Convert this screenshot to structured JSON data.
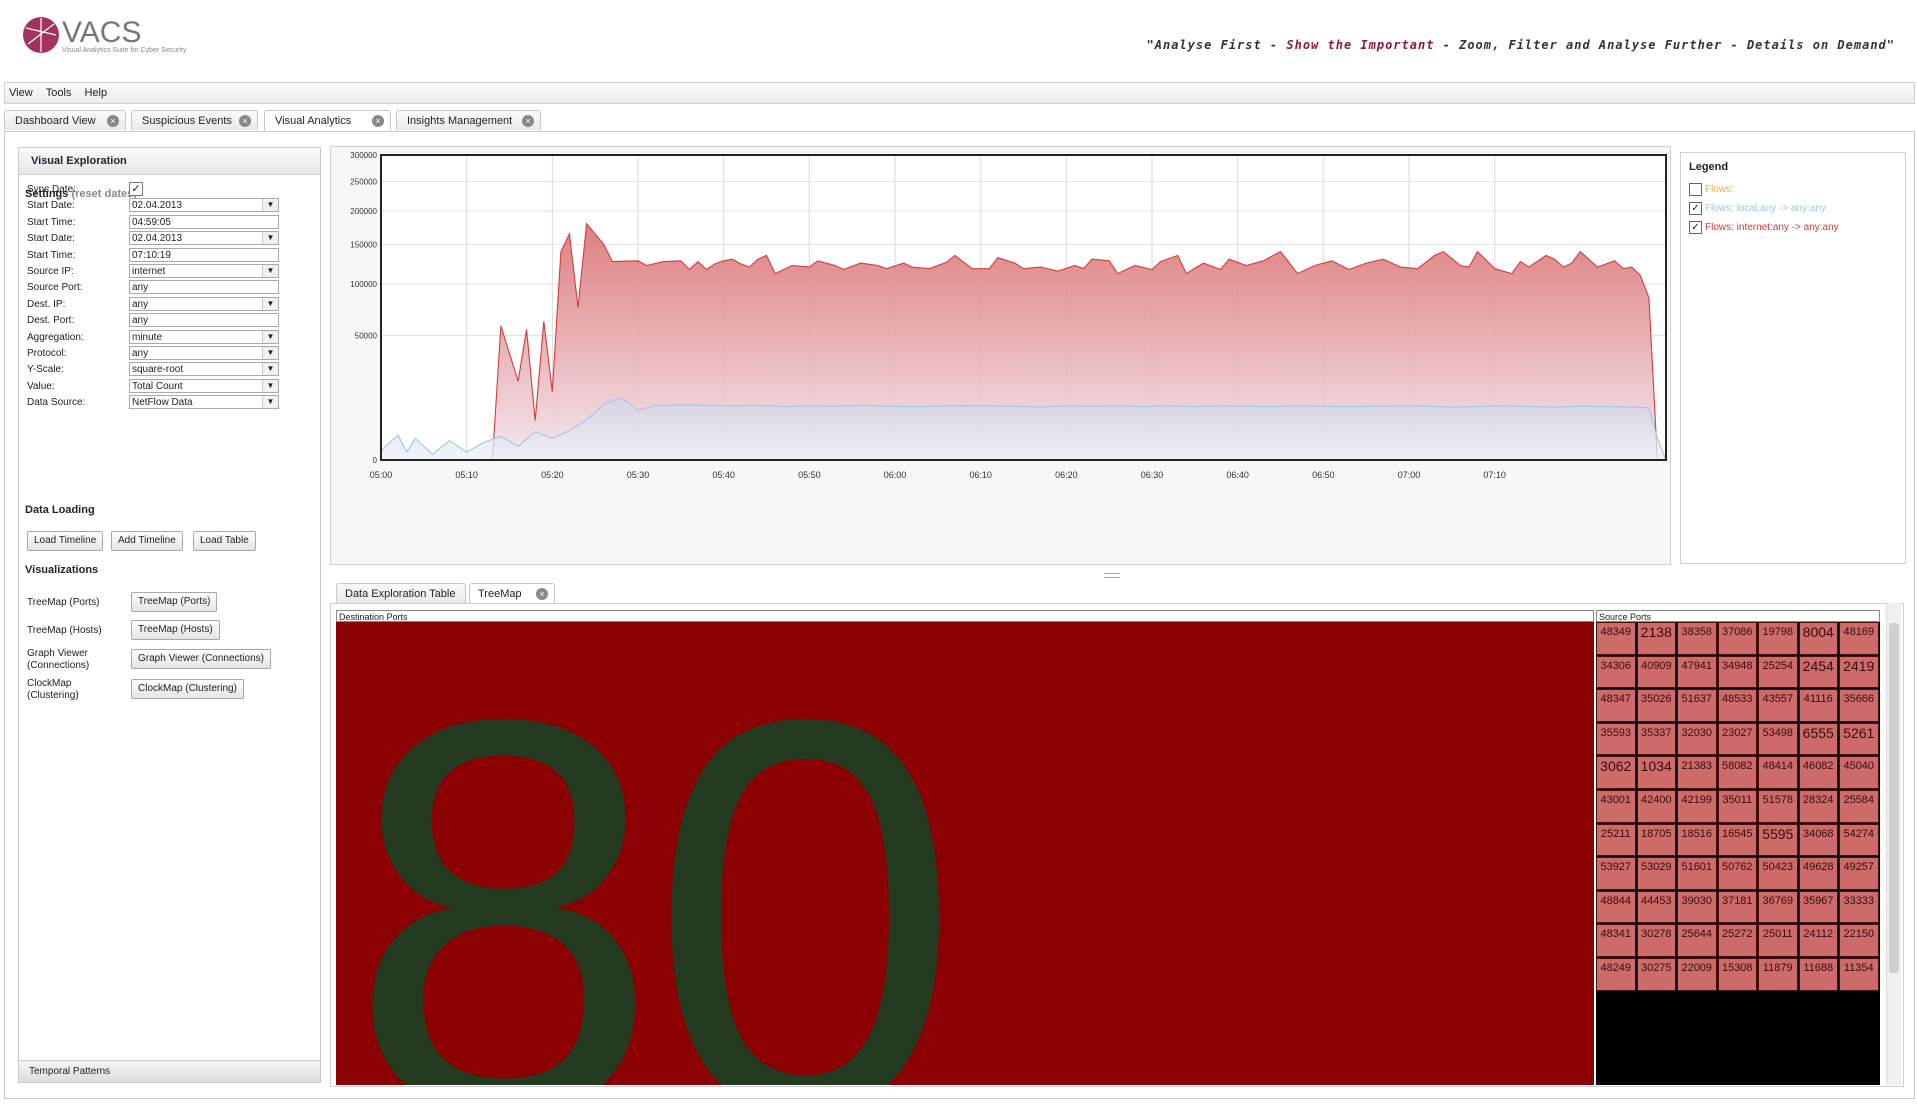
{
  "app": {
    "logo_text": "VACS",
    "logo_subtitle": "Visual Analytics Suite for Cyber Security",
    "tagline_parts": [
      "\"Analyse First - ",
      "Show the Important",
      " - Zoom, Filter and Analyse Further - Details on Demand\""
    ]
  },
  "menu": [
    "View",
    "Tools",
    "Help"
  ],
  "tabs": [
    {
      "label": "Dashboard View"
    },
    {
      "label": "Suspicious Events"
    },
    {
      "label": "Visual Analytics"
    },
    {
      "label": "Insights Management"
    }
  ],
  "left_panel": {
    "title": "Visual Exploration",
    "settings_title": "Settings",
    "reset_link": "(reset dates)",
    "fields": [
      {
        "label": "Sync Date:",
        "type": "checkbox",
        "value": "✓"
      },
      {
        "label": "Start Date:",
        "type": "select",
        "value": "02.04.2013"
      },
      {
        "label": "Start Time:",
        "type": "text",
        "value": "04:59:05"
      },
      {
        "label": "Start Date:",
        "type": "select",
        "value": "02.04.2013"
      },
      {
        "label": "Start Time:",
        "type": "text",
        "value": "07:10:19"
      },
      {
        "label": "Source IP:",
        "type": "select",
        "value": "internet"
      },
      {
        "label": "Source Port:",
        "type": "text",
        "value": "any"
      },
      {
        "label": "Dest. IP:",
        "type": "select",
        "value": "any"
      },
      {
        "label": "Dest. Port:",
        "type": "text",
        "value": "any"
      },
      {
        "label": "Aggregation:",
        "type": "select",
        "value": "minute"
      },
      {
        "label": "Protocol:",
        "type": "select",
        "value": "any"
      },
      {
        "label": "Y-Scale:",
        "type": "select",
        "value": "square-root"
      },
      {
        "label": "Value:",
        "type": "select",
        "value": "Total Count"
      },
      {
        "label": "Data Source:",
        "type": "select",
        "value": "NetFlow Data"
      }
    ],
    "data_loading_title": "Data Loading",
    "load_buttons": [
      "Load Timeline",
      "Add Timeline",
      "Load Table"
    ],
    "visualizations_title": "Visualizations",
    "visualizations": [
      {
        "label": "TreeMap (Ports)",
        "button": "TreeMap (Ports)"
      },
      {
        "label": "TreeMap (Hosts)",
        "button": "TreeMap (Hosts)"
      },
      {
        "label": "Graph Viewer (Connections)",
        "button": "Graph Viewer (Connections)"
      },
      {
        "label": "ClockMap (Clustering)",
        "button": "ClockMap (Clustering)"
      }
    ],
    "footer": "Temporal Patterns"
  },
  "legend": {
    "title": "Legend",
    "items": [
      {
        "label": "Flows:",
        "checked": false,
        "color": "#e8b04a"
      },
      {
        "label": "Flows: local:any -> any:any",
        "checked": true,
        "color": "#9ec4e6"
      },
      {
        "label": "Flows: internet:any -> any:any",
        "checked": true,
        "color": "#d23c3c"
      }
    ]
  },
  "chart_data": {
    "type": "area",
    "yscale": "square-root",
    "ylim": [
      0,
      300000
    ],
    "y_ticks": [
      0,
      50000,
      100000,
      150000,
      200000,
      250000,
      300000
    ],
    "x_ticks": [
      "05:00",
      "05:10",
      "05:20",
      "05:30",
      "05:40",
      "05:50",
      "06:00",
      "06:10",
      "06:20",
      "06:30",
      "06:40",
      "06:50",
      "07:00",
      "07:10"
    ],
    "x_range_minutes": [
      0,
      130
    ],
    "grid": true,
    "series": [
      {
        "name": "Flows: internet:any -> any:any",
        "color": "#d23c3c",
        "points": [
          [
            0,
            0
          ],
          [
            13,
            0
          ],
          [
            14,
            58000
          ],
          [
            16,
            20000
          ],
          [
            17,
            55000
          ],
          [
            18,
            5000
          ],
          [
            19,
            62000
          ],
          [
            20,
            15000
          ],
          [
            21,
            140000
          ],
          [
            22,
            165000
          ],
          [
            23,
            75000
          ],
          [
            24,
            180000
          ],
          [
            26,
            150000
          ],
          [
            27,
            127000
          ],
          [
            30,
            128000
          ],
          [
            31,
            122000
          ],
          [
            33,
            127000
          ],
          [
            35,
            128000
          ],
          [
            36,
            117000
          ],
          [
            37,
            127000
          ],
          [
            38,
            117000
          ],
          [
            39,
            124000
          ],
          [
            40,
            128000
          ],
          [
            41,
            130000
          ],
          [
            42,
            124000
          ],
          [
            43,
            120000
          ],
          [
            44,
            130000
          ],
          [
            45,
            135000
          ],
          [
            46,
            112000
          ],
          [
            48,
            122000
          ],
          [
            50,
            120000
          ],
          [
            51,
            128000
          ],
          [
            53,
            122000
          ],
          [
            54,
            117000
          ],
          [
            56,
            125000
          ],
          [
            58,
            122000
          ],
          [
            59,
            118000
          ],
          [
            61,
            125000
          ],
          [
            62,
            120000
          ],
          [
            64,
            118000
          ],
          [
            66,
            126000
          ],
          [
            67,
            135000
          ],
          [
            69,
            118000
          ],
          [
            71,
            118000
          ],
          [
            72,
            132000
          ],
          [
            74,
            125000
          ],
          [
            75,
            118000
          ],
          [
            77,
            120000
          ],
          [
            79,
            115000
          ],
          [
            81,
            122000
          ],
          [
            82,
            118000
          ],
          [
            83,
            130000
          ],
          [
            85,
            128000
          ],
          [
            86,
            112000
          ],
          [
            88,
            122000
          ],
          [
            90,
            117000
          ],
          [
            91,
            127000
          ],
          [
            93,
            135000
          ],
          [
            94,
            112000
          ],
          [
            96,
            125000
          ],
          [
            98,
            117000
          ],
          [
            99,
            130000
          ],
          [
            101,
            122000
          ],
          [
            103,
            128000
          ],
          [
            105,
            140000
          ],
          [
            107,
            112000
          ],
          [
            109,
            122000
          ],
          [
            111,
            128000
          ],
          [
            113,
            117000
          ],
          [
            115,
            125000
          ],
          [
            117,
            130000
          ],
          [
            119,
            120000
          ],
          [
            121,
            118000
          ],
          [
            123,
            135000
          ],
          [
            124,
            140000
          ],
          [
            126,
            122000
          ],
          [
            127,
            120000
          ],
          [
            128,
            140000
          ],
          [
            130,
            118000
          ],
          [
            132,
            112000
          ],
          [
            133,
            127000
          ],
          [
            134,
            120000
          ],
          [
            136,
            135000
          ],
          [
            137,
            130000
          ],
          [
            138,
            120000
          ],
          [
            139,
            125000
          ],
          [
            140,
            140000
          ],
          [
            142,
            120000
          ],
          [
            144,
            128000
          ],
          [
            145,
            118000
          ],
          [
            146,
            120000
          ],
          [
            147,
            110000
          ],
          [
            148,
            85000
          ],
          [
            149,
            0
          ],
          [
            150,
            0
          ]
        ]
      },
      {
        "name": "Flows: local:any -> any:any",
        "color": "#9ec4e6",
        "points": [
          [
            0,
            300
          ],
          [
            2,
            2000
          ],
          [
            3,
            200
          ],
          [
            4,
            1500
          ],
          [
            6,
            100
          ],
          [
            8,
            1200
          ],
          [
            10,
            200
          ],
          [
            12,
            1000
          ],
          [
            14,
            1800
          ],
          [
            16,
            600
          ],
          [
            18,
            2600
          ],
          [
            20,
            1500
          ],
          [
            22,
            2800
          ],
          [
            24,
            5200
          ],
          [
            26,
            10000
          ],
          [
            28,
            12500
          ],
          [
            30,
            8000
          ],
          [
            32,
            9600
          ],
          [
            35,
            9800
          ],
          [
            38,
            9700
          ],
          [
            41,
            9400
          ],
          [
            44,
            9700
          ],
          [
            47,
            9200
          ],
          [
            50,
            9400
          ],
          [
            53,
            9300
          ],
          [
            56,
            9700
          ],
          [
            59,
            9300
          ],
          [
            62,
            9200
          ],
          [
            65,
            9300
          ],
          [
            68,
            9500
          ],
          [
            71,
            9400
          ],
          [
            74,
            9300
          ],
          [
            77,
            9100
          ],
          [
            80,
            9400
          ],
          [
            83,
            9300
          ],
          [
            86,
            9400
          ],
          [
            89,
            9200
          ],
          [
            92,
            9400
          ],
          [
            95,
            9200
          ],
          [
            98,
            9400
          ],
          [
            101,
            9300
          ],
          [
            104,
            9200
          ],
          [
            107,
            9400
          ],
          [
            110,
            9300
          ],
          [
            113,
            9200
          ],
          [
            116,
            9300
          ],
          [
            119,
            9400
          ],
          [
            122,
            9300
          ],
          [
            125,
            9100
          ],
          [
            128,
            9200
          ],
          [
            131,
            9400
          ],
          [
            134,
            9200
          ],
          [
            137,
            9100
          ],
          [
            140,
            9300
          ],
          [
            143,
            9200
          ],
          [
            146,
            9100
          ],
          [
            148,
            8800
          ],
          [
            149,
            1500
          ],
          [
            150,
            0
          ]
        ]
      }
    ]
  },
  "bottom_tabs": [
    {
      "label": "Data Exploration Table"
    },
    {
      "label": "TreeMap"
    }
  ],
  "treemap": {
    "dest_header": "Destination Ports",
    "dest_label": "80",
    "dest_color": "#8b0000",
    "src_header": "Source Ports",
    "src_cells": [
      "48349",
      "2138",
      "38358",
      "37086",
      "19798",
      "8004",
      "48169",
      "34306",
      "40909",
      "47941",
      "34948",
      "25254",
      "2454",
      "2419",
      "48347",
      "35026",
      "51637",
      "48533",
      "43557",
      "41116",
      "35666",
      "35593",
      "35337",
      "32030",
      "23027",
      "53498",
      "6555",
      "5261",
      "3062",
      "1034",
      "21383",
      "58082",
      "48414",
      "46082",
      "45040",
      "43001",
      "42400",
      "42199",
      "35011",
      "51578",
      "28324",
      "25584",
      "25211",
      "18705",
      "18516",
      "16545",
      "5595",
      "34068",
      "54274",
      "53927",
      "53029",
      "51601",
      "50762",
      "50423",
      "49628",
      "49257",
      "48844",
      "44453",
      "39030",
      "37181",
      "36769",
      "35967",
      "33333",
      "48341",
      "30278",
      "25644",
      "25272",
      "25011",
      "24112",
      "22150",
      "48249",
      "30275",
      "22009",
      "15308",
      "11879",
      "11688",
      "11354"
    ]
  }
}
